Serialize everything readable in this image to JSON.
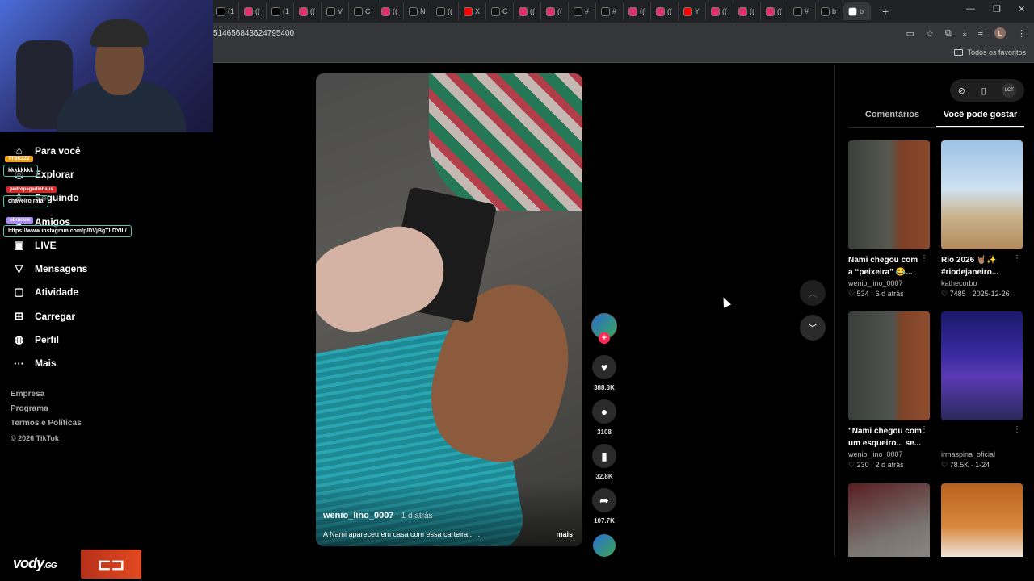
{
  "browser": {
    "url": "514656843624795400",
    "favorites_label": "Todos os favoritos",
    "profile_initial": "L",
    "tabs": [
      {
        "label": "(1",
        "color": "#000000"
      },
      {
        "label": "((",
        "color": "#e1306c"
      },
      {
        "label": "(1",
        "color": "#000000"
      },
      {
        "label": "((",
        "color": "#e1306c"
      },
      {
        "label": "V",
        "color": "#111111"
      },
      {
        "label": "C",
        "color": "#111111"
      },
      {
        "label": "((",
        "color": "#e1306c"
      },
      {
        "label": "N",
        "color": "#111111"
      },
      {
        "label": "((",
        "color": "#111111"
      },
      {
        "label": "X",
        "color": "#ff0000"
      },
      {
        "label": "C",
        "color": "#111111"
      },
      {
        "label": "((",
        "color": "#e1306c"
      },
      {
        "label": "((",
        "color": "#e1306c"
      },
      {
        "label": "#",
        "color": "#111111"
      },
      {
        "label": "#",
        "color": "#111111"
      },
      {
        "label": "((",
        "color": "#e1306c"
      },
      {
        "label": "((",
        "color": "#e1306c"
      },
      {
        "label": "Y",
        "color": "#ff0000"
      },
      {
        "label": "((",
        "color": "#e1306c"
      },
      {
        "label": "((",
        "color": "#e1306c"
      },
      {
        "label": "((",
        "color": "#e1306c"
      },
      {
        "label": "#",
        "color": "#111111"
      },
      {
        "label": "b",
        "color": "#111111"
      },
      {
        "label": "b",
        "color": "#ffffff"
      }
    ]
  },
  "nav": {
    "items": [
      {
        "label": "Para você",
        "icon": "home-icon"
      },
      {
        "label": "Explorar",
        "icon": "compass-icon"
      },
      {
        "label": "Seguindo",
        "icon": "following-icon"
      },
      {
        "label": "Amigos",
        "icon": "friends-icon"
      },
      {
        "label": "LIVE",
        "icon": "live-icon"
      },
      {
        "label": "Mensagens",
        "icon": "send-icon"
      },
      {
        "label": "Atividade",
        "icon": "activity-icon"
      },
      {
        "label": "Carregar",
        "icon": "upload-icon"
      },
      {
        "label": "Perfil",
        "icon": "profile-icon"
      },
      {
        "label": "Mais",
        "icon": "more-icon"
      }
    ],
    "footer": [
      "Empresa",
      "Programa",
      "Termos e Políticas"
    ],
    "copyright": "© 2026 TikTok"
  },
  "chat": {
    "messages": [
      {
        "tag": "TTBKZZZ",
        "tag_color": "#f59e0b",
        "text": "kkkkkkkk"
      },
      {
        "tag": "pedropegadinhaus",
        "tag_color": "#dc2626",
        "text": "chaveiro rafa"
      },
      {
        "tag": "obrunow",
        "tag_color": "#a78bfa",
        "text": "https://www.instagram.com/p/DVjBgTLDYlL/"
      }
    ]
  },
  "watermark": {
    "text": "vody",
    "suffix": ".GG"
  },
  "video": {
    "author": "wenio_lino_0007",
    "ago": "· 1 d atrás",
    "caption": "A Nami apareceu em casa com essa carteira... ...",
    "more": "mais"
  },
  "actions": {
    "likes": "388.3K",
    "comments": "3108",
    "saves": "32.8K",
    "shares": "107.7K"
  },
  "panel": {
    "tabs": [
      "Comentários",
      "Você pode gostar"
    ],
    "active_tab": 1,
    "logo_mini": "LCT",
    "cards": [
      {
        "title": "Nami chegou com a “peixeira” 😂...",
        "author": "wenio_lino_0007",
        "meta": "♡ 534 · 6 d atrás"
      },
      {
        "title": "Rio 2026 🤘🏽✨ #riodejaneiro...",
        "author": "kathecorbo",
        "meta": "♡ 7485 · 2025-12-26"
      },
      {
        "title": "\"Nami chegou com um esqueiro... se...",
        "author": "wenio_lino_0007",
        "meta": "♡ 230 · 2 d atrás"
      },
      {
        "title": "",
        "author": "irmaspina_oficial",
        "meta": "♡ 78.5K · 1-24"
      },
      {
        "title": "",
        "author": "",
        "meta": ""
      },
      {
        "title": "",
        "author": "",
        "meta": ""
      }
    ]
  }
}
